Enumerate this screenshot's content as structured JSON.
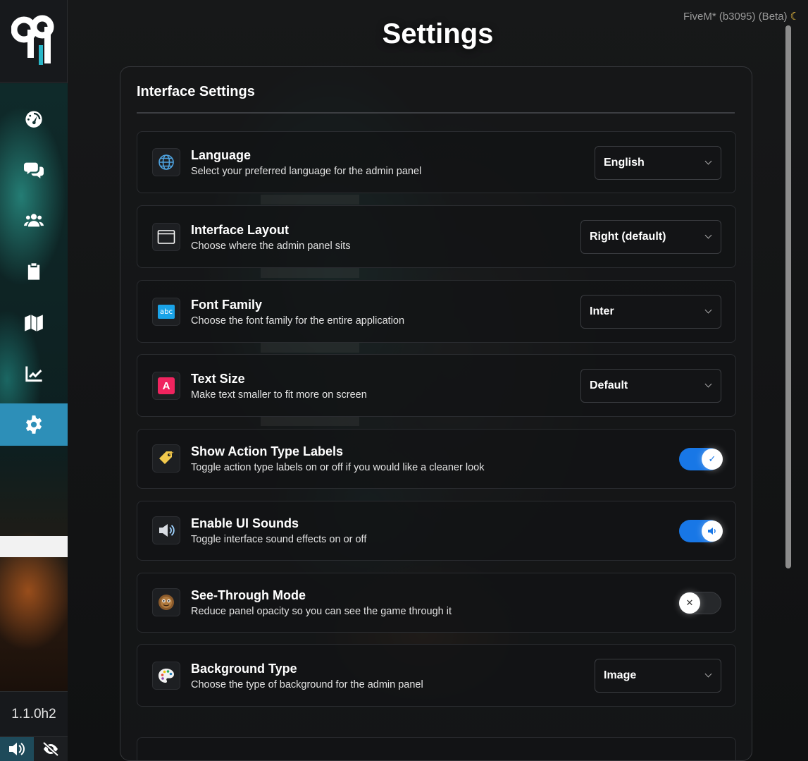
{
  "app": {
    "env_label": "FiveM* (b3095) (Beta)",
    "theme_icon": "moon-icon",
    "version": "1.1.0h2"
  },
  "sidebar": {
    "items": [
      {
        "name": "dashboard",
        "icon": "gauge-icon"
      },
      {
        "name": "chat",
        "icon": "comments-icon"
      },
      {
        "name": "players",
        "icon": "users-icon"
      },
      {
        "name": "reports",
        "icon": "clipboard-icon"
      },
      {
        "name": "map",
        "icon": "map-icon"
      },
      {
        "name": "stats",
        "icon": "chart-line-icon"
      },
      {
        "name": "settings",
        "icon": "gear-icon",
        "active": true
      }
    ],
    "bottom": [
      {
        "name": "sound",
        "icon": "volume-icon",
        "active": true
      },
      {
        "name": "visibility",
        "icon": "eye-slash-icon"
      }
    ]
  },
  "page": {
    "title": "Settings"
  },
  "panel": {
    "title": "Interface Settings",
    "settings": [
      {
        "label": "Language",
        "desc": "Select your preferred language for the admin panel",
        "icon": "globe-icon",
        "control": "select",
        "value": "English"
      },
      {
        "label": "Interface Layout",
        "desc": "Choose where the admin panel sits",
        "icon": "window-icon",
        "control": "select",
        "value": "Right (default)"
      },
      {
        "label": "Font Family",
        "desc": "Choose the font family for the entire application",
        "icon": "abc-icon",
        "icon_text": "abc",
        "control": "select",
        "value": "Inter"
      },
      {
        "label": "Text Size",
        "desc": "Make text smaller to fit more on screen",
        "icon": "letter-a-icon",
        "icon_text": "A",
        "control": "select",
        "value": "Default"
      },
      {
        "label": "Show Action Type Labels",
        "desc": "Toggle action type labels on or off if you would like a cleaner look",
        "icon": "tag-icon",
        "control": "toggle",
        "value": true
      },
      {
        "label": "Enable UI Sounds",
        "desc": "Toggle interface sound effects on or off",
        "icon": "speaker-icon",
        "control": "toggle",
        "value": true
      },
      {
        "label": "See-Through Mode",
        "desc": "Reduce panel opacity so you can see the game through it",
        "icon": "face-icon",
        "control": "toggle",
        "value": false
      },
      {
        "label": "Background Type",
        "desc": "Choose the type of background for the admin panel",
        "icon": "palette-icon",
        "control": "select",
        "value": "Image"
      }
    ]
  },
  "colors": {
    "accent": "#1877e6",
    "nav_active": "#2d8fb8"
  }
}
